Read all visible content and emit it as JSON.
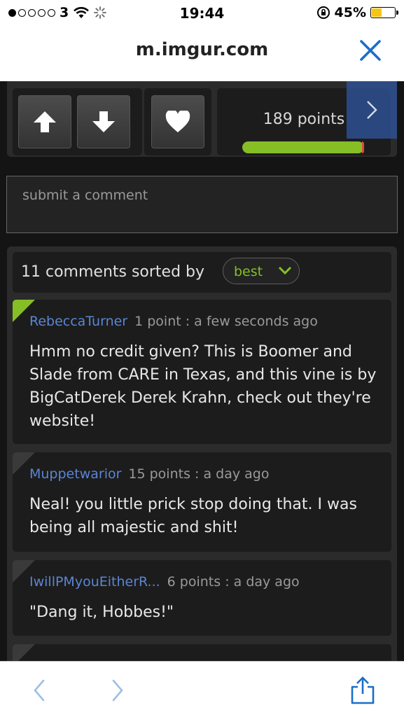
{
  "status_bar": {
    "carrier": "3",
    "time": "19:44",
    "battery_percent_label": "45%",
    "battery_level": 0.45
  },
  "browser": {
    "url": "m.imgur.com"
  },
  "post": {
    "points_label": "189 points",
    "upvote_ratio": 0.98
  },
  "comment_input": {
    "placeholder": "submit a comment"
  },
  "comments_header": {
    "summary": "11 comments sorted by",
    "sort_value": "best"
  },
  "comments": [
    {
      "username": "RebeccaTurner",
      "meta": "1 point : a few seconds ago",
      "text": "Hmm no credit given? This is Boomer and Slade from CARE in Texas, and this vine is by BigCatDerek Derek Krahn, check out they're website!"
    },
    {
      "username": "Muppetwarior",
      "meta": "15 points : a day ago",
      "text": "Neal! you little prick stop doing that. I was being all majestic and shit!"
    },
    {
      "username": "IwillPMyouEitherR...",
      "meta": "6 points : a day ago",
      "text": "\"Dang it, Hobbes!\""
    }
  ],
  "colors": {
    "accent_green": "#85bf25",
    "username_blue": "#5b85d4",
    "ios_blue": "#1a6ec9"
  }
}
